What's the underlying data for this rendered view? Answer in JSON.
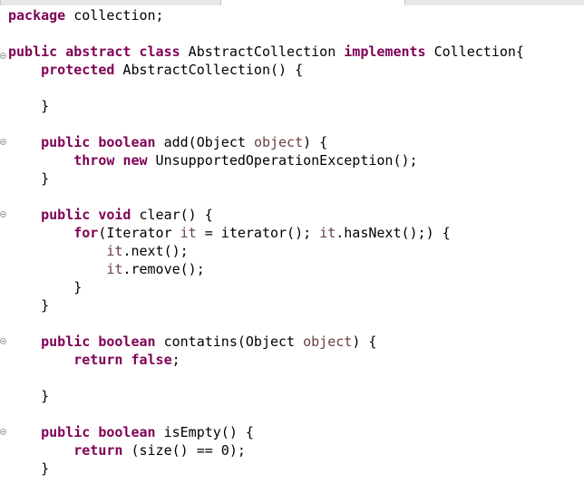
{
  "colors": {
    "background": "#ffffff",
    "keyword": "#7f0055",
    "identifier": "#000000",
    "local_variable": "#6a3e3e",
    "fold_marker": "#a0a0a0"
  },
  "gutter": {
    "fold_markers": [
      "collapse-icon",
      "collapse-icon",
      "collapse-icon",
      "collapse-icon",
      "collapse-icon"
    ]
  },
  "code_lines": [
    [
      {
        "t": "package",
        "c": "kw"
      },
      {
        "t": " collection;",
        "c": "plain"
      }
    ],
    [],
    [
      {
        "t": "public",
        "c": "kw"
      },
      {
        "t": " ",
        "c": "plain"
      },
      {
        "t": "abstract",
        "c": "kw"
      },
      {
        "t": " ",
        "c": "plain"
      },
      {
        "t": "class",
        "c": "kw"
      },
      {
        "t": " AbstractCollection ",
        "c": "plain"
      },
      {
        "t": "implements",
        "c": "kw"
      },
      {
        "t": " Collection{",
        "c": "plain"
      }
    ],
    [
      {
        "t": "    ",
        "c": "plain"
      },
      {
        "t": "protected",
        "c": "kw"
      },
      {
        "t": " AbstractCollection() {",
        "c": "plain"
      }
    ],
    [],
    [
      {
        "t": "    }",
        "c": "plain"
      }
    ],
    [],
    [
      {
        "t": "    ",
        "c": "plain"
      },
      {
        "t": "public",
        "c": "kw"
      },
      {
        "t": " ",
        "c": "plain"
      },
      {
        "t": "boolean",
        "c": "kw"
      },
      {
        "t": " add(Object ",
        "c": "plain"
      },
      {
        "t": "object",
        "c": "field"
      },
      {
        "t": ") {",
        "c": "plain"
      }
    ],
    [
      {
        "t": "        ",
        "c": "plain"
      },
      {
        "t": "throw",
        "c": "kw"
      },
      {
        "t": " ",
        "c": "plain"
      },
      {
        "t": "new",
        "c": "kw"
      },
      {
        "t": " UnsupportedOperationException();",
        "c": "plain"
      }
    ],
    [
      {
        "t": "    }",
        "c": "plain"
      }
    ],
    [],
    [
      {
        "t": "    ",
        "c": "plain"
      },
      {
        "t": "public",
        "c": "kw"
      },
      {
        "t": " ",
        "c": "plain"
      },
      {
        "t": "void",
        "c": "kw"
      },
      {
        "t": " clear() {",
        "c": "plain"
      }
    ],
    [
      {
        "t": "        ",
        "c": "plain"
      },
      {
        "t": "for",
        "c": "kw"
      },
      {
        "t": "(Iterator ",
        "c": "plain"
      },
      {
        "t": "it",
        "c": "field"
      },
      {
        "t": " = iterator(); ",
        "c": "plain"
      },
      {
        "t": "it",
        "c": "field"
      },
      {
        "t": ".hasNext();) {",
        "c": "plain"
      }
    ],
    [
      {
        "t": "            ",
        "c": "plain"
      },
      {
        "t": "it",
        "c": "field"
      },
      {
        "t": ".next();",
        "c": "plain"
      }
    ],
    [
      {
        "t": "            ",
        "c": "plain"
      },
      {
        "t": "it",
        "c": "field"
      },
      {
        "t": ".remove();",
        "c": "plain"
      }
    ],
    [
      {
        "t": "        }",
        "c": "plain"
      }
    ],
    [
      {
        "t": "    }",
        "c": "plain"
      }
    ],
    [],
    [
      {
        "t": "    ",
        "c": "plain"
      },
      {
        "t": "public",
        "c": "kw"
      },
      {
        "t": " ",
        "c": "plain"
      },
      {
        "t": "boolean",
        "c": "kw"
      },
      {
        "t": " contatins(Object ",
        "c": "plain"
      },
      {
        "t": "object",
        "c": "field"
      },
      {
        "t": ") {",
        "c": "plain"
      }
    ],
    [
      {
        "t": "        ",
        "c": "plain"
      },
      {
        "t": "return",
        "c": "kw"
      },
      {
        "t": " ",
        "c": "plain"
      },
      {
        "t": "false",
        "c": "kw"
      },
      {
        "t": ";",
        "c": "plain"
      }
    ],
    [],
    [
      {
        "t": "    }",
        "c": "plain"
      }
    ],
    [],
    [
      {
        "t": "    ",
        "c": "plain"
      },
      {
        "t": "public",
        "c": "kw"
      },
      {
        "t": " ",
        "c": "plain"
      },
      {
        "t": "boolean",
        "c": "kw"
      },
      {
        "t": " isEmpty() {",
        "c": "plain"
      }
    ],
    [
      {
        "t": "        ",
        "c": "plain"
      },
      {
        "t": "return",
        "c": "kw"
      },
      {
        "t": " (size() == 0);",
        "c": "plain"
      }
    ],
    [
      {
        "t": "    }",
        "c": "plain"
      }
    ]
  ]
}
